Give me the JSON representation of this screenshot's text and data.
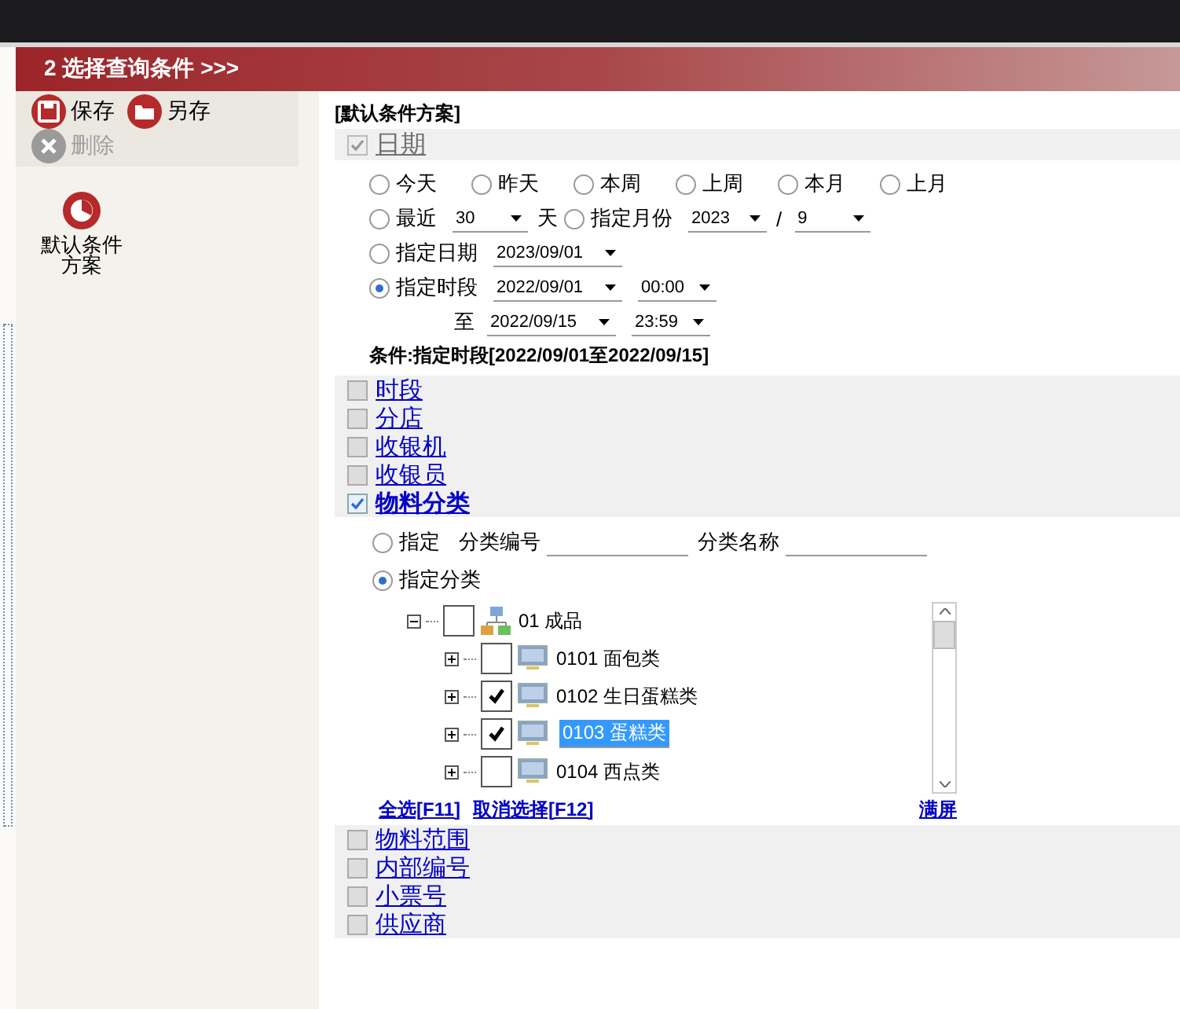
{
  "header": {
    "title": "2 选择查询条件 >>>"
  },
  "toolbar": [
    {
      "kind": "save",
      "label": "保存",
      "disabled": false
    },
    {
      "kind": "saveas",
      "label": "另存",
      "disabled": false
    },
    {
      "kind": "delete",
      "label": "删除",
      "disabled": true
    }
  ],
  "schemes": [
    {
      "label": "默认条件方案"
    }
  ],
  "scheme_title": "[默认条件方案]",
  "date_section": {
    "label": "日期",
    "checked": true,
    "disabled": true,
    "quick_options": [
      {
        "label": "今天",
        "selected": false
      },
      {
        "label": "昨天",
        "selected": false
      },
      {
        "label": "本周",
        "selected": false
      },
      {
        "label": "上周",
        "selected": false
      },
      {
        "label": "本月",
        "selected": false
      },
      {
        "label": "上月",
        "selected": false
      }
    ],
    "lines": [
      {
        "items": [
          {
            "kind": "radio",
            "label": "最近",
            "selected": false
          },
          {
            "kind": "select",
            "value": "30"
          },
          {
            "kind": "text",
            "label": "天"
          },
          {
            "kind": "radio",
            "label": "指定月份",
            "selected": false
          },
          {
            "kind": "select",
            "value": "2023"
          },
          {
            "kind": "text",
            "label": "/"
          },
          {
            "kind": "select",
            "value": "9"
          }
        ]
      },
      {
        "items": [
          {
            "kind": "radio",
            "label": "指定日期",
            "selected": false
          },
          {
            "kind": "select",
            "value": "2023/09/01"
          }
        ]
      },
      {
        "items": [
          {
            "kind": "radio",
            "label": "指定时段",
            "selected": true
          },
          {
            "kind": "select",
            "value": "2022/09/01"
          },
          {
            "kind": "select",
            "value": "00:00"
          }
        ]
      },
      {
        "items": [
          {
            "kind": "indent-text",
            "label": "至"
          },
          {
            "kind": "select",
            "value": "2022/09/15"
          },
          {
            "kind": "select",
            "value": "23:59"
          }
        ]
      }
    ],
    "condition": "条件:指定时段[2022/09/01至2022/09/15]"
  },
  "sections": [
    {
      "label": "时段",
      "checked": false
    },
    {
      "label": "分店",
      "checked": false
    },
    {
      "label": "收银机",
      "checked": false
    },
    {
      "label": "收银员",
      "checked": false
    },
    {
      "label": "物料分类",
      "checked": true,
      "kind": "category"
    },
    {
      "label": "物料范围",
      "checked": false
    },
    {
      "label": "内部编号",
      "checked": false
    },
    {
      "label": "小票号",
      "checked": false
    },
    {
      "label": "供应商",
      "checked": false
    }
  ],
  "category_panel": {
    "options": [
      {
        "label": "指定",
        "selected": false
      },
      {
        "label": "指定分类",
        "selected": true
      }
    ],
    "fields": [
      {
        "label": "分类编号"
      },
      {
        "label": "分类名称"
      }
    ],
    "tree": {
      "code": "01",
      "name": "成品",
      "checked": false,
      "expanded": true,
      "children": [
        {
          "code": "0101",
          "name": "面包类",
          "checked": false,
          "selected": false
        },
        {
          "code": "0102",
          "name": "生日蛋糕类",
          "checked": true,
          "selected": false
        },
        {
          "code": "0103",
          "name": "蛋糕类",
          "checked": true,
          "selected": true
        },
        {
          "code": "0104",
          "name": "西点类",
          "checked": false,
          "selected": false
        }
      ]
    },
    "links": [
      "全选[F11]",
      "取消选择[F12]"
    ],
    "fullscreen_link": "满屏"
  }
}
